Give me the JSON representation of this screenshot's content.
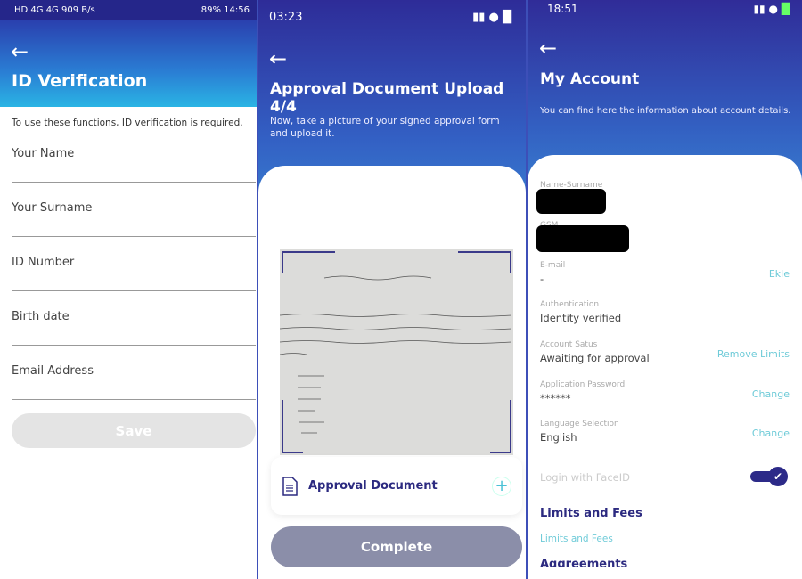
{
  "screen1": {
    "status": {
      "left": "HD 4G 4G 909 B/s",
      "battery": "89%",
      "time": "14:56"
    },
    "title": "ID Verification",
    "info": "To use these functions, ID verification is required.",
    "fields": [
      "Your Name",
      "Your Surname",
      "ID Number",
      "Birth date",
      "Email Address"
    ],
    "save_label": "Save"
  },
  "screen2": {
    "status": {
      "time": "03:23"
    },
    "title": "Approval Document Upload  4/4",
    "subtitle": "Now, take a picture of your signed approval form and upload it.",
    "document_label": "Approval Document",
    "complete_label": "Complete"
  },
  "screen3": {
    "status": {
      "time": "18:51"
    },
    "title": "My Account",
    "subtitle": "You can find here the information about account details.",
    "rows": [
      {
        "label": "Name-Surname",
        "value": "",
        "action": ""
      },
      {
        "label": "GSM",
        "value": "",
        "action": ""
      },
      {
        "label": "E-mail",
        "value": "-",
        "action": "Ekle"
      },
      {
        "label": "Authentication",
        "value": "Identity verified",
        "action": ""
      },
      {
        "label": "Account Satus",
        "value": "Awaiting for approval",
        "action": "Remove Limits"
      },
      {
        "label": "Application Password",
        "value": "******",
        "action": "Change"
      },
      {
        "label": "Language Selection",
        "value": "English",
        "action": "Change"
      }
    ],
    "faceid_label": "Login with FaceID",
    "faceid_enabled": true,
    "limits_heading": "Limits and Fees",
    "limits_link": "Limits and Fees",
    "agreements_heading": "Aggreements"
  },
  "colors": {
    "primary": "#2c2a88",
    "accent": "#6fcbd8"
  }
}
